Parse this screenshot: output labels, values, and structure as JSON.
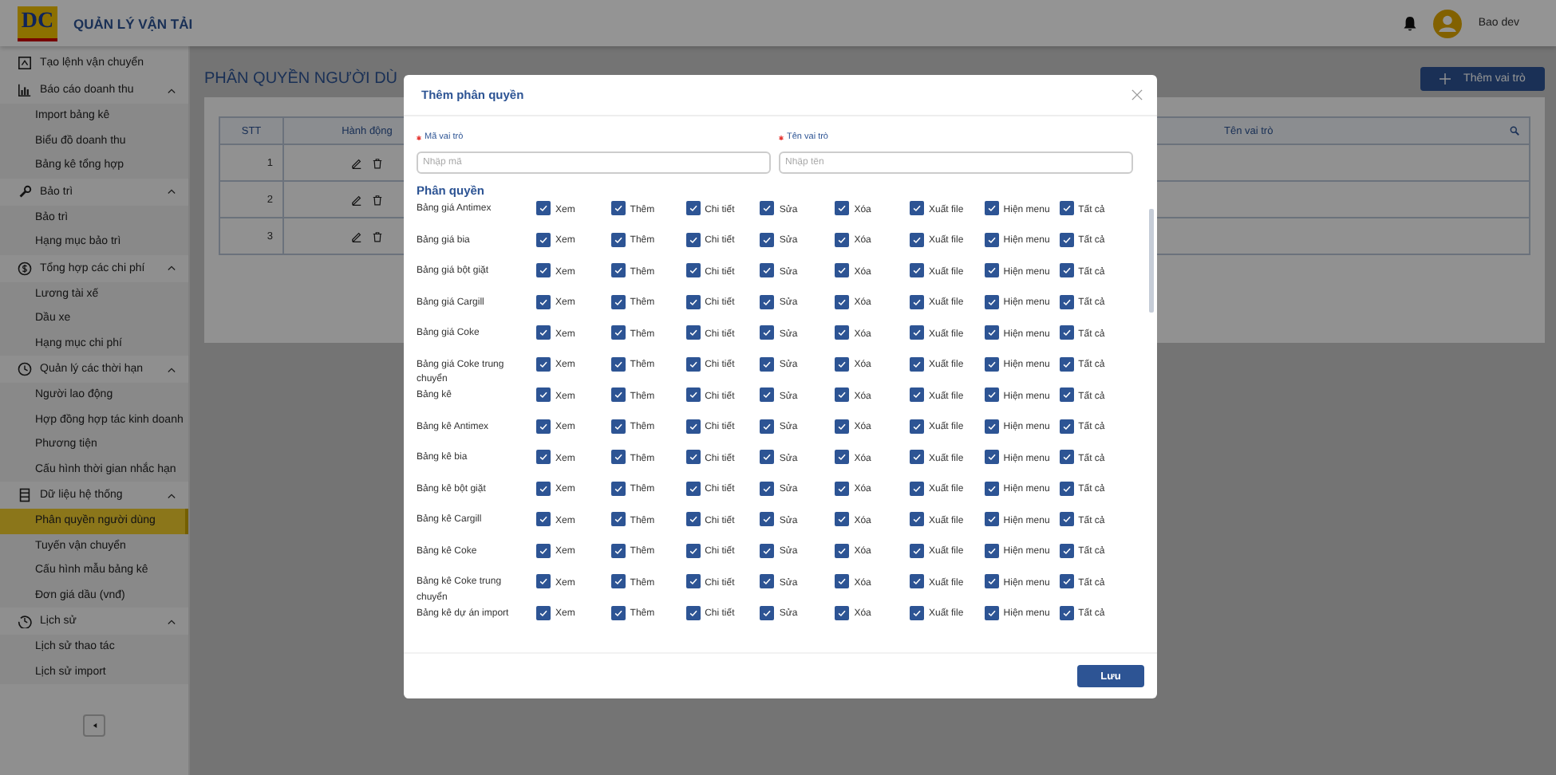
{
  "app": {
    "logo_text": "DC",
    "title": "QUẢN LÝ VẬN TẢI"
  },
  "header": {
    "user_name": "Bao dev"
  },
  "sidebar": {
    "items": [
      {
        "kind": "link",
        "label": "Tạo lệnh vận chuyển",
        "selected": false
      },
      {
        "kind": "group",
        "label": "Báo cáo doanh thu",
        "expanded": true,
        "children": [
          {
            "label": "Import bảng kê",
            "selected": false
          },
          {
            "label": "Biểu đồ doanh thu",
            "selected": false
          },
          {
            "label": "Bảng kê tổng hợp",
            "selected": false
          }
        ]
      },
      {
        "kind": "group",
        "label": "Bảo trì",
        "expanded": true,
        "children": [
          {
            "label": "Bảo trì",
            "selected": false
          },
          {
            "label": "Hạng mục bảo trì",
            "selected": false
          }
        ]
      },
      {
        "kind": "group",
        "label": "Tổng hợp các chi phí",
        "expanded": true,
        "children": [
          {
            "label": "Lương tài xế",
            "selected": false
          },
          {
            "label": "Dầu xe",
            "selected": false
          },
          {
            "label": "Hạng mục chi phí",
            "selected": false
          }
        ]
      },
      {
        "kind": "group",
        "label": "Quản lý các thời hạn",
        "expanded": true,
        "children": [
          {
            "label": "Người lao động",
            "selected": false
          },
          {
            "label": "Hợp đồng hợp tác kinh doanh",
            "selected": false
          },
          {
            "label": "Phương tiện",
            "selected": false
          },
          {
            "label": "Cấu hình thời gian nhắc hạn",
            "selected": false
          }
        ]
      },
      {
        "kind": "group",
        "label": "Dữ liệu hệ thống",
        "expanded": true,
        "children": [
          {
            "label": "Phân quyền người dùng",
            "selected": true
          },
          {
            "label": "Tuyến vận chuyển",
            "selected": false
          },
          {
            "label": "Cấu hình mẫu bảng kê",
            "selected": false
          },
          {
            "label": "Đơn giá dầu (vnđ)",
            "selected": false
          }
        ]
      },
      {
        "kind": "group",
        "label": "Lịch sử",
        "expanded": true,
        "children": [
          {
            "label": "Lịch sử thao tác",
            "selected": false
          },
          {
            "label": "Lịch sử import",
            "selected": false
          }
        ]
      }
    ]
  },
  "page": {
    "title": "PHÂN QUYỀN NGƯỜI DÙ",
    "add_button": "Thêm vai trò",
    "table": {
      "columns": [
        "STT",
        "Hành động",
        "Tên vai trò"
      ],
      "rows": [
        {
          "stt": "1"
        },
        {
          "stt": "2"
        },
        {
          "stt": "3"
        }
      ]
    }
  },
  "modal": {
    "title": "Thêm phân quyền",
    "fields": [
      {
        "label": "Mã vai trò",
        "required": true,
        "placeholder": "Nhập mã"
      },
      {
        "label": "Tên vai trò",
        "required": true,
        "placeholder": "Nhập tên"
      }
    ],
    "section_title": "Phân quyền",
    "permissions": [
      {
        "name": "Bảng giá Antimex",
        "options": [
          {
            "label": "Xem",
            "checked": true
          },
          {
            "label": "Thêm",
            "checked": true
          },
          {
            "label": "Chi tiết",
            "checked": true
          },
          {
            "label": "Sửa",
            "checked": true
          },
          {
            "label": "Xóa",
            "checked": true
          },
          {
            "label": "Xuất file",
            "checked": true
          },
          {
            "label": "Hiện menu",
            "checked": true
          },
          {
            "label": "Tất cả",
            "checked": true
          }
        ]
      },
      {
        "name": "Bảng giá bia",
        "options": [
          {
            "label": "Xem",
            "checked": true
          },
          {
            "label": "Thêm",
            "checked": true
          },
          {
            "label": "Chi tiết",
            "checked": true
          },
          {
            "label": "Sửa",
            "checked": true
          },
          {
            "label": "Xóa",
            "checked": true
          },
          {
            "label": "Xuất file",
            "checked": true
          },
          {
            "label": "Hiện menu",
            "checked": true
          },
          {
            "label": "Tất cả",
            "checked": true
          }
        ]
      },
      {
        "name": "Bảng giá bột giặt",
        "options": [
          {
            "label": "Xem",
            "checked": true
          },
          {
            "label": "Thêm",
            "checked": true
          },
          {
            "label": "Chi tiết",
            "checked": true
          },
          {
            "label": "Sửa",
            "checked": true
          },
          {
            "label": "Xóa",
            "checked": true
          },
          {
            "label": "Xuất file",
            "checked": true
          },
          {
            "label": "Hiện menu",
            "checked": true
          },
          {
            "label": "Tất cả",
            "checked": true
          }
        ]
      },
      {
        "name": "Bảng giá Cargill",
        "options": [
          {
            "label": "Xem",
            "checked": true
          },
          {
            "label": "Thêm",
            "checked": true
          },
          {
            "label": "Chi tiết",
            "checked": true
          },
          {
            "label": "Sửa",
            "checked": true
          },
          {
            "label": "Xóa",
            "checked": true
          },
          {
            "label": "Xuất file",
            "checked": true
          },
          {
            "label": "Hiện menu",
            "checked": true
          },
          {
            "label": "Tất cả",
            "checked": true
          }
        ]
      },
      {
        "name": "Bảng giá Coke",
        "options": [
          {
            "label": "Xem",
            "checked": true
          },
          {
            "label": "Thêm",
            "checked": true
          },
          {
            "label": "Chi tiết",
            "checked": true
          },
          {
            "label": "Sửa",
            "checked": true
          },
          {
            "label": "Xóa",
            "checked": true
          },
          {
            "label": "Xuất file",
            "checked": true
          },
          {
            "label": "Hiện menu",
            "checked": true
          },
          {
            "label": "Tất cả",
            "checked": true
          }
        ]
      },
      {
        "name": "Bảng giá Coke trung chuyển",
        "options": [
          {
            "label": "Xem",
            "checked": true
          },
          {
            "label": "Thêm",
            "checked": true
          },
          {
            "label": "Chi tiết",
            "checked": true
          },
          {
            "label": "Sửa",
            "checked": true
          },
          {
            "label": "Xóa",
            "checked": true
          },
          {
            "label": "Xuất file",
            "checked": true
          },
          {
            "label": "Hiện menu",
            "checked": true
          },
          {
            "label": "Tất cả",
            "checked": true
          }
        ]
      },
      {
        "name": "Bảng kê",
        "options": [
          {
            "label": "Xem",
            "checked": true
          },
          {
            "label": "Thêm",
            "checked": true
          },
          {
            "label": "Chi tiết",
            "checked": true
          },
          {
            "label": "Sửa",
            "checked": true
          },
          {
            "label": "Xóa",
            "checked": true
          },
          {
            "label": "Xuất file",
            "checked": true
          },
          {
            "label": "Hiện menu",
            "checked": true
          },
          {
            "label": "Tất cả",
            "checked": true
          }
        ]
      },
      {
        "name": "Bảng kê Antimex",
        "options": [
          {
            "label": "Xem",
            "checked": true
          },
          {
            "label": "Thêm",
            "checked": true
          },
          {
            "label": "Chi tiết",
            "checked": true
          },
          {
            "label": "Sửa",
            "checked": true
          },
          {
            "label": "Xóa",
            "checked": true
          },
          {
            "label": "Xuất file",
            "checked": true
          },
          {
            "label": "Hiện menu",
            "checked": true
          },
          {
            "label": "Tất cả",
            "checked": true
          }
        ]
      },
      {
        "name": "Bảng kê bia",
        "options": [
          {
            "label": "Xem",
            "checked": true
          },
          {
            "label": "Thêm",
            "checked": true
          },
          {
            "label": "Chi tiết",
            "checked": true
          },
          {
            "label": "Sửa",
            "checked": true
          },
          {
            "label": "Xóa",
            "checked": true
          },
          {
            "label": "Xuất file",
            "checked": true
          },
          {
            "label": "Hiện menu",
            "checked": true
          },
          {
            "label": "Tất cả",
            "checked": true
          }
        ]
      },
      {
        "name": "Bảng kê bột giặt",
        "options": [
          {
            "label": "Xem",
            "checked": true
          },
          {
            "label": "Thêm",
            "checked": true
          },
          {
            "label": "Chi tiết",
            "checked": true
          },
          {
            "label": "Sửa",
            "checked": true
          },
          {
            "label": "Xóa",
            "checked": true
          },
          {
            "label": "Xuất file",
            "checked": true
          },
          {
            "label": "Hiện menu",
            "checked": true
          },
          {
            "label": "Tất cả",
            "checked": true
          }
        ]
      },
      {
        "name": "Bảng kê Cargill",
        "options": [
          {
            "label": "Xem",
            "checked": true
          },
          {
            "label": "Thêm",
            "checked": true
          },
          {
            "label": "Chi tiết",
            "checked": true
          },
          {
            "label": "Sửa",
            "checked": true
          },
          {
            "label": "Xóa",
            "checked": true
          },
          {
            "label": "Xuất file",
            "checked": true
          },
          {
            "label": "Hiện menu",
            "checked": true
          },
          {
            "label": "Tất cả",
            "checked": true
          }
        ]
      },
      {
        "name": "Bảng kê Coke",
        "options": [
          {
            "label": "Xem",
            "checked": true
          },
          {
            "label": "Thêm",
            "checked": true
          },
          {
            "label": "Chi tiết",
            "checked": true
          },
          {
            "label": "Sửa",
            "checked": true
          },
          {
            "label": "Xóa",
            "checked": true
          },
          {
            "label": "Xuất file",
            "checked": true
          },
          {
            "label": "Hiện menu",
            "checked": true
          },
          {
            "label": "Tất cả",
            "checked": true
          }
        ]
      },
      {
        "name": "Bảng kê Coke trung chuyển",
        "options": [
          {
            "label": "Xem",
            "checked": true
          },
          {
            "label": "Thêm",
            "checked": true
          },
          {
            "label": "Chi tiết",
            "checked": true
          },
          {
            "label": "Sửa",
            "checked": true
          },
          {
            "label": "Xóa",
            "checked": true
          },
          {
            "label": "Xuất file",
            "checked": true
          },
          {
            "label": "Hiện menu",
            "checked": true
          },
          {
            "label": "Tất cả",
            "checked": true
          }
        ]
      },
      {
        "name": "Bảng kê dự án import",
        "options": [
          {
            "label": "Xem",
            "checked": true
          },
          {
            "label": "Thêm",
            "checked": true
          },
          {
            "label": "Chi tiết",
            "checked": true
          },
          {
            "label": "Sửa",
            "checked": true
          },
          {
            "label": "Xóa",
            "checked": true
          },
          {
            "label": "Xuất file",
            "checked": true
          },
          {
            "label": "Hiện menu",
            "checked": true
          },
          {
            "label": "Tất cả",
            "checked": true
          }
        ]
      }
    ],
    "save_button": "Lưu"
  }
}
